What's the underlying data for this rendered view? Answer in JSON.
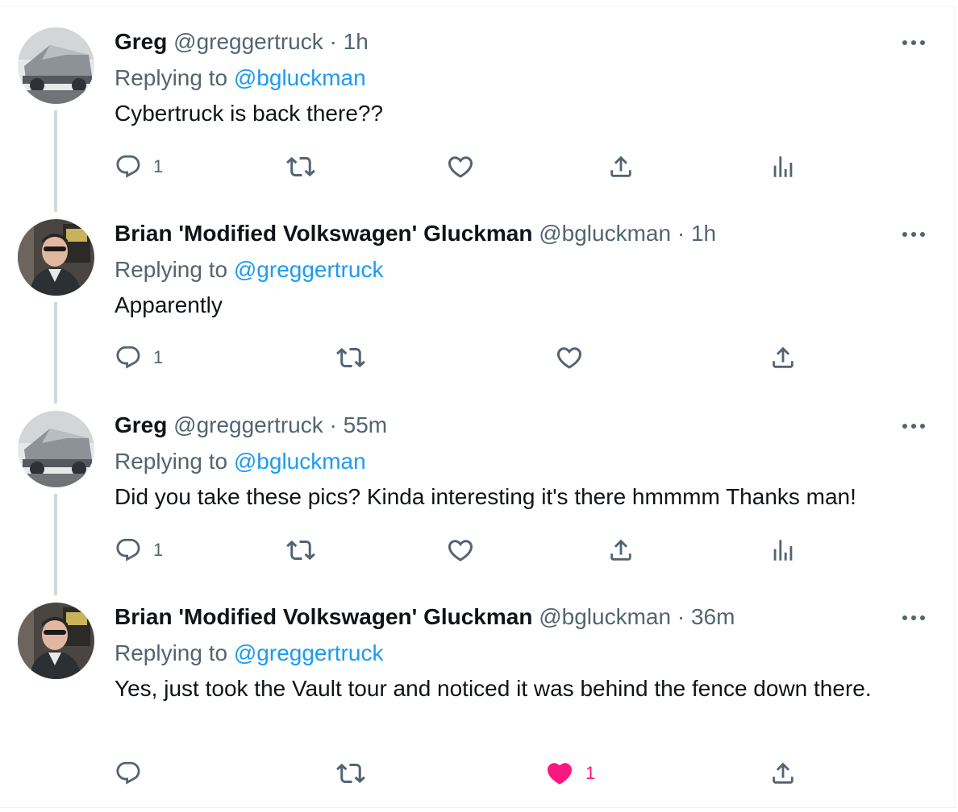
{
  "colors": {
    "link": "#1d9bf0",
    "muted": "#536471",
    "text": "#0f1419",
    "thread_line": "#cfd9de",
    "like_active": "#f91880"
  },
  "tweets": [
    {
      "display_name": "Greg",
      "handle": "@greggertruck",
      "time": "· 1h",
      "replying_prefix": "Replying to",
      "replying_handle": "@bgluckman",
      "text": "Cybertruck is back there??",
      "reply_count": "1",
      "like_count": "",
      "avatar": "cybertruck-photo",
      "show_analytics": true
    },
    {
      "display_name": "Brian 'Modified Volkswagen' Gluckman",
      "handle": "@bgluckman",
      "time": "· 1h",
      "replying_prefix": "Replying to",
      "replying_handle": "@greggertruck",
      "text": "Apparently",
      "reply_count": "1",
      "like_count": "",
      "avatar": "person-photo",
      "show_analytics": false
    },
    {
      "display_name": "Greg",
      "handle": "@greggertruck",
      "time": "· 55m",
      "replying_prefix": "Replying to",
      "replying_handle": "@bgluckman",
      "text": "Did you take these pics? Kinda interesting it's there hmmmm Thanks man!",
      "reply_count": "1",
      "like_count": "",
      "avatar": "cybertruck-photo",
      "show_analytics": true
    },
    {
      "display_name": "Brian 'Modified Volkswagen' Gluckman",
      "handle": "@bgluckman",
      "time": "· 36m",
      "replying_prefix": "Replying to",
      "replying_handle": "@greggertruck",
      "text": "Yes, just took the Vault tour and noticed it was behind the fence down there.",
      "reply_count": "",
      "like_count": "1",
      "liked": true,
      "avatar": "person-photo",
      "show_analytics": false
    }
  ]
}
